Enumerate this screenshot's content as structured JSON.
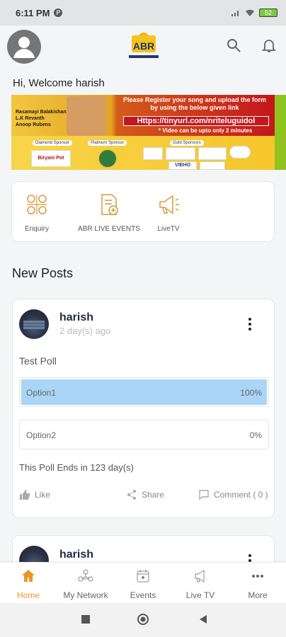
{
  "status_bar": {
    "time": "6:11 PM",
    "app_badge": "P",
    "battery": "52"
  },
  "header": {
    "logo_alt": "ABR"
  },
  "welcome_text": "Hi, Welcome harish",
  "banner": {
    "names": [
      "Rasamayi Balakishan",
      "L.K Revanth",
      "Anoop Rubens"
    ],
    "register_text": "Please Register your song and upload the form by using the below given link",
    "url": "Https://tinyurl.com/nriteluguidol",
    "note": "* Video can be upto only 2 minutes",
    "sponsor_tags": [
      "Diamond Sponsor",
      "Platinum Sponsor",
      "Gold Sponsors"
    ],
    "sponsor_name": "Biryani Pot",
    "gold_sponsor_name": "VIBHO"
  },
  "quick_links": [
    {
      "label": "Enquiry",
      "icon": "enquiry-icon"
    },
    {
      "label": "ABR LIVE EVENTS",
      "icon": "document-add-icon"
    },
    {
      "label": "LiveTV",
      "icon": "megaphone-icon"
    }
  ],
  "section_title": "New Posts",
  "post": {
    "author": "harish",
    "time": "2 day(s) ago",
    "question": "Test Poll",
    "options": [
      {
        "label": "Option1",
        "percent": "100%",
        "fill": 1.0
      },
      {
        "label": "Option2",
        "percent": "0%",
        "fill": 0.0
      }
    ],
    "ends": "This Poll Ends in 123 day(s)",
    "actions": {
      "like": "Like",
      "share": "Share",
      "comment": "Comment ( 0 )"
    }
  },
  "post2": {
    "author": "harish"
  },
  "bottom_nav": [
    {
      "label": "Home",
      "icon": "home-icon",
      "active": true
    },
    {
      "label": "My Network",
      "icon": "network-icon",
      "active": false
    },
    {
      "label": "Events",
      "icon": "events-icon",
      "active": false
    },
    {
      "label": "Live TV",
      "icon": "live-tv-icon",
      "active": false
    },
    {
      "label": "More",
      "icon": "more-icon",
      "active": false
    }
  ],
  "colors": {
    "accent": "#e8952b",
    "poll_fill": "#a9d5f7",
    "banner_red": "#c4161c"
  }
}
